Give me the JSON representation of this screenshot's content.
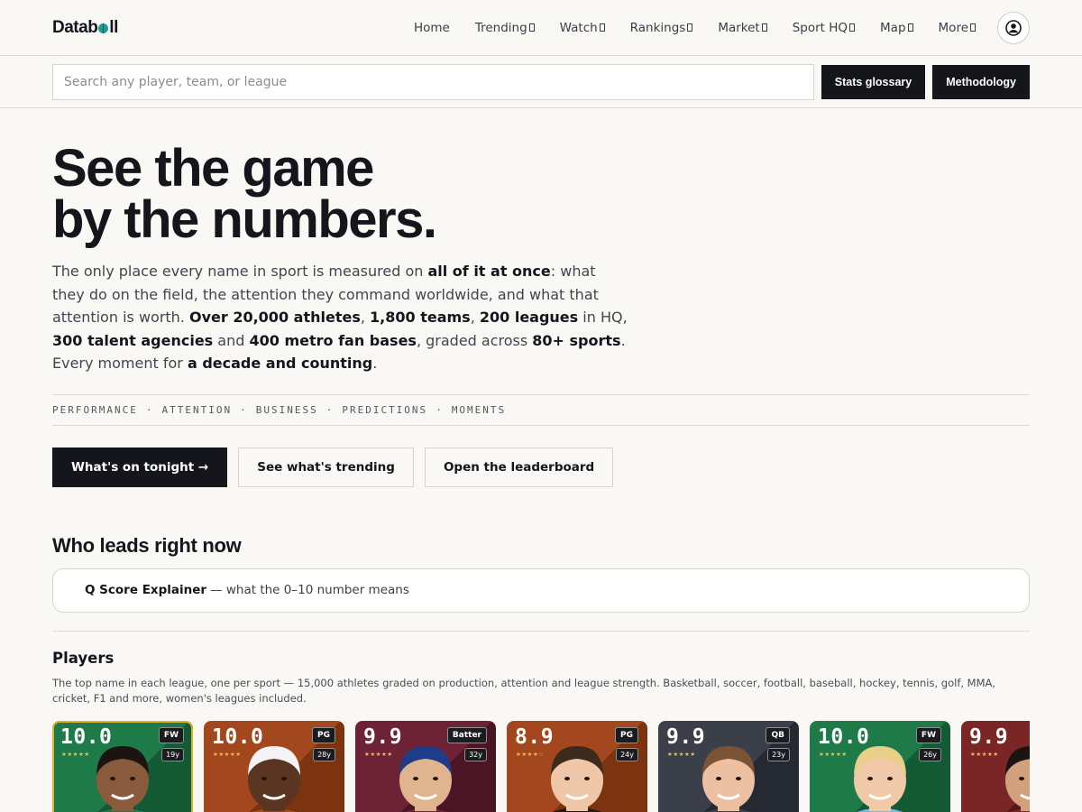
{
  "brand": {
    "logo_left": "Data",
    "logo_right": "ll"
  },
  "nav": {
    "items": [
      {
        "label": "Home",
        "dropdown": false
      },
      {
        "label": "Trending",
        "dropdown": true
      },
      {
        "label": "Watch",
        "dropdown": true
      },
      {
        "label": "Rankings",
        "dropdown": true
      },
      {
        "label": "Market",
        "dropdown": true
      },
      {
        "label": "Sport HQ",
        "dropdown": true
      },
      {
        "label": "Map",
        "dropdown": true
      },
      {
        "label": "More",
        "dropdown": true
      }
    ]
  },
  "search": {
    "placeholder": "Search any player, team, or league",
    "glossary_label": "Stats glossary",
    "methodology_label": "Methodology"
  },
  "hero": {
    "headline_line1": "See the game",
    "headline_line2": "by the numbers.",
    "lede": [
      {
        "t": "The only place every name in sport is measured on ",
        "b": false
      },
      {
        "t": "all of it at once",
        "b": true
      },
      {
        "t": ": what they do on the field, the attention they command worldwide, and what that attention is worth. ",
        "b": false
      },
      {
        "t": "Over 20,000 athletes",
        "b": true
      },
      {
        "t": ", ",
        "b": false
      },
      {
        "t": "1,800 teams",
        "b": true
      },
      {
        "t": ", ",
        "b": false
      },
      {
        "t": "200 leagues",
        "b": true
      },
      {
        "t": " in HQ, ",
        "b": false
      },
      {
        "t": "300 talent agencies",
        "b": true
      },
      {
        "t": " and ",
        "b": false
      },
      {
        "t": "400 metro fan bases",
        "b": true
      },
      {
        "t": ", graded across ",
        "b": false
      },
      {
        "t": "80+ sports",
        "b": true
      },
      {
        "t": ". Every moment for ",
        "b": false
      },
      {
        "t": "a decade and counting",
        "b": true
      },
      {
        "t": ".",
        "b": false
      }
    ],
    "pillars": [
      "PERFORMANCE",
      "ATTENTION",
      "BUSINESS",
      "PREDICTIONS",
      "MOMENTS"
    ],
    "pillar_separator": "·",
    "cta_primary": "What's on tonight →",
    "cta_trending": "See what's trending",
    "cta_leaderboard": "Open the leaderboard"
  },
  "leaders": {
    "title": "Who leads right now",
    "explainer_bold": "Q Score Explainer",
    "explainer_rest": "— what the 0–10 number means"
  },
  "players": {
    "title": "Players",
    "description": "The top name in each league, one per sport — 15,000 athletes graded on production, attention and league strength. Basketball, soccer, football, baseball, hockey, tennis, golf, MMA, cricket, F1 and more, women's leagues included.",
    "cards": [
      {
        "score": "10.0",
        "pos": "FW",
        "age": "19y",
        "stars": "★★★★★",
        "bg1": "#1f7a4a",
        "bg2": "#145a35",
        "skin": "#8a5a3c",
        "hair": "#1b1410",
        "shirt": "#1f7a4a",
        "selected": true
      },
      {
        "score": "10.0",
        "pos": "PG",
        "age": "28y",
        "stars": "★★★★★",
        "bg1": "#a3481e",
        "bg2": "#7c3310",
        "skin": "#5a3622",
        "hair": "#f4f4f4",
        "shirt": "#a3481e",
        "selected": false
      },
      {
        "score": "9.9",
        "pos": "Batter",
        "age": "32y",
        "stars": "★★★★★",
        "bg1": "#6d2236",
        "bg2": "#4c1524",
        "skin": "#e0b48e",
        "hair": "#1e3c8a",
        "shirt": "#6d2236",
        "selected": false
      },
      {
        "score": "8.9",
        "pos": "PG",
        "age": "24y",
        "stars": "★★★★☆",
        "bg1": "#a3481e",
        "bg2": "#7c3310",
        "skin": "#efc7a8",
        "hair": "#3d2a1c",
        "shirt": "#1b1b1b",
        "selected": false
      },
      {
        "score": "9.9",
        "pos": "QB",
        "age": "23y",
        "stars": "★★★★★",
        "bg1": "#3a3f4a",
        "bg2": "#252932",
        "skin": "#ecc0a0",
        "hair": "#7a5434",
        "shirt": "#3a3f4a",
        "selected": false
      },
      {
        "score": "10.0",
        "pos": "FW",
        "age": "26y",
        "stars": "★★★★★",
        "bg1": "#1f7a4a",
        "bg2": "#145a35",
        "skin": "#f0caa8",
        "hair": "#e8d08a",
        "shirt": "#7ab8e8",
        "selected": false
      },
      {
        "score": "9.9",
        "pos": "",
        "age": "",
        "stars": "★★★★★",
        "bg1": "#7a2626",
        "bg2": "#561616",
        "skin": "#d2a07c",
        "hair": "#1b1410",
        "shirt": "#7a2626",
        "selected": false
      }
    ]
  }
}
